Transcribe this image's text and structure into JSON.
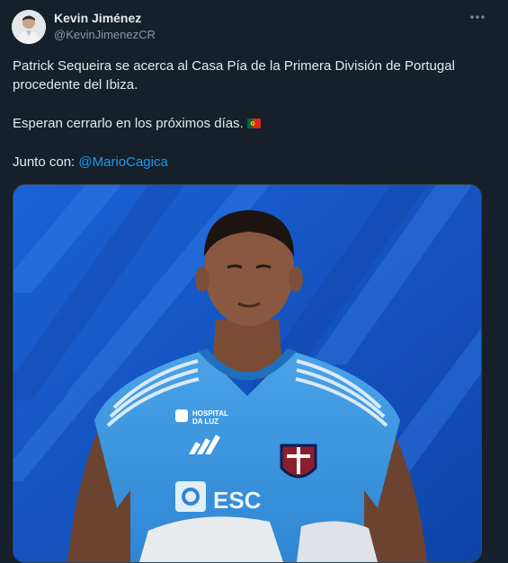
{
  "author": {
    "name": "Kevin Jiménez",
    "handle": "@KevinJimenezCR"
  },
  "tweet": {
    "line1": "Patrick Sequeira se acerca al Casa Pía de la Primera División de Portugal procedente del Ibiza.",
    "line2": "Esperan cerrarlo en los próximos días.",
    "line3_prefix": "Junto con:",
    "mention": "@MarioCagica"
  },
  "media": {
    "jersey_sponsor_1": "HOSPITAL",
    "jersey_sponsor_2": "DA LUZ",
    "jersey_front_text": "ESC"
  },
  "icons": {
    "more": "more-horizontal-icon",
    "flag": "portugal-flag-icon"
  },
  "colors": {
    "background": "#15202b",
    "mention": "#1d9bf0",
    "secondary_text": "#8b98a5"
  }
}
